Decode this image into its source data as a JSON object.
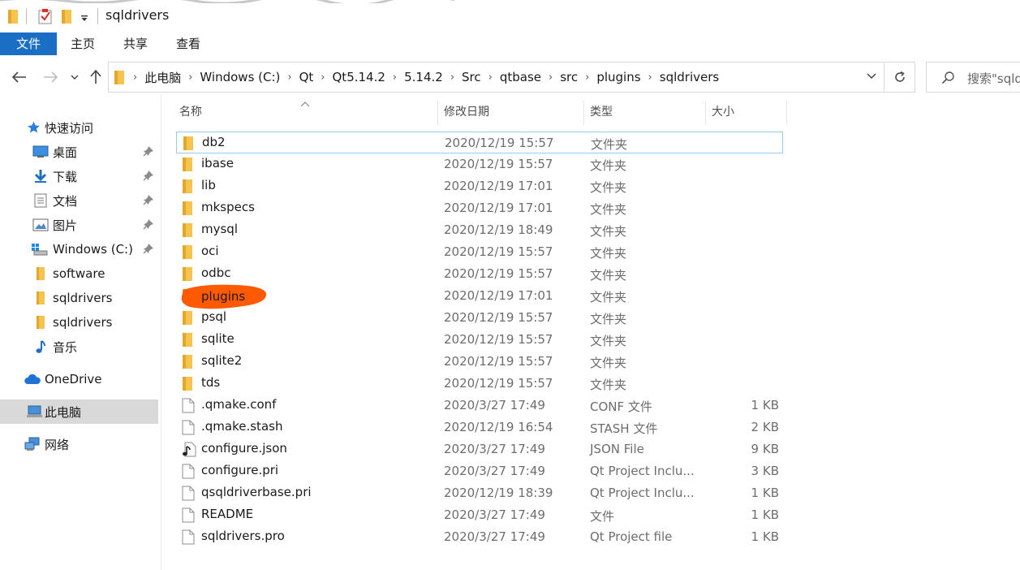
{
  "window": {
    "title": "sqldrivers"
  },
  "ribbon": {
    "tabs": [
      {
        "label": "文件",
        "active": true
      },
      {
        "label": "主页"
      },
      {
        "label": "共享"
      },
      {
        "label": "查看"
      }
    ]
  },
  "address": {
    "crumbs": [
      "此电脑",
      "Windows (C:)",
      "Qt",
      "Qt5.14.2",
      "5.14.2",
      "Src",
      "qtbase",
      "src",
      "plugins",
      "sqldrivers"
    ]
  },
  "search": {
    "placeholder": "搜索\"sqldrivers\""
  },
  "sidebar": {
    "items": [
      {
        "label": "快速访问",
        "icon": "star-icon",
        "pinned": false
      },
      {
        "label": "桌面",
        "icon": "desktop-icon",
        "pinned": true
      },
      {
        "label": "下载",
        "icon": "download-icon",
        "pinned": true
      },
      {
        "label": "文档",
        "icon": "document-icon",
        "pinned": true
      },
      {
        "label": "图片",
        "icon": "pictures-icon",
        "pinned": true
      },
      {
        "label": "Windows (C:)",
        "icon": "drive-icon",
        "pinned": true
      },
      {
        "label": "software",
        "icon": "folder-icon",
        "pinned": false
      },
      {
        "label": "sqldrivers",
        "icon": "folder-icon",
        "pinned": false
      },
      {
        "label": "sqldrivers",
        "icon": "folder-icon",
        "pinned": false
      },
      {
        "label": "音乐",
        "icon": "music-icon",
        "pinned": false
      },
      {
        "label": "OneDrive",
        "icon": "cloud-icon",
        "pinned": false
      },
      {
        "label": "此电脑",
        "icon": "computer-icon",
        "pinned": false,
        "selected": true
      },
      {
        "label": "网络",
        "icon": "network-icon",
        "pinned": false
      }
    ]
  },
  "columns": {
    "name": "名称",
    "date": "修改日期",
    "type": "类型",
    "size": "大小"
  },
  "files": [
    {
      "name": "db2",
      "date": "2020/12/19 15:57",
      "type": "文件夹",
      "size": "",
      "kind": "folder"
    },
    {
      "name": "ibase",
      "date": "2020/12/19 15:57",
      "type": "文件夹",
      "size": "",
      "kind": "folder"
    },
    {
      "name": "lib",
      "date": "2020/12/19 17:01",
      "type": "文件夹",
      "size": "",
      "kind": "folder"
    },
    {
      "name": "mkspecs",
      "date": "2020/12/19 17:01",
      "type": "文件夹",
      "size": "",
      "kind": "folder"
    },
    {
      "name": "mysql",
      "date": "2020/12/19 18:49",
      "type": "文件夹",
      "size": "",
      "kind": "folder"
    },
    {
      "name": "oci",
      "date": "2020/12/19 15:57",
      "type": "文件夹",
      "size": "",
      "kind": "folder"
    },
    {
      "name": "odbc",
      "date": "2020/12/19 15:57",
      "type": "文件夹",
      "size": "",
      "kind": "folder"
    },
    {
      "name": "plugins",
      "date": "2020/12/19 17:01",
      "type": "文件夹",
      "size": "",
      "kind": "folder"
    },
    {
      "name": "psql",
      "date": "2020/12/19 15:57",
      "type": "文件夹",
      "size": "",
      "kind": "folder"
    },
    {
      "name": "sqlite",
      "date": "2020/12/19 15:57",
      "type": "文件夹",
      "size": "",
      "kind": "folder"
    },
    {
      "name": "sqlite2",
      "date": "2020/12/19 15:57",
      "type": "文件夹",
      "size": "",
      "kind": "folder"
    },
    {
      "name": "tds",
      "date": "2020/12/19 15:57",
      "type": "文件夹",
      "size": "",
      "kind": "folder"
    },
    {
      "name": ".qmake.conf",
      "date": "2020/3/27 17:49",
      "type": "CONF 文件",
      "size": "1 KB",
      "kind": "file"
    },
    {
      "name": ".qmake.stash",
      "date": "2020/12/19 16:54",
      "type": "STASH 文件",
      "size": "2 KB",
      "kind": "file"
    },
    {
      "name": "configure.json",
      "date": "2020/3/27 17:49",
      "type": "JSON File",
      "size": "9 KB",
      "kind": "json"
    },
    {
      "name": "configure.pri",
      "date": "2020/3/27 17:49",
      "type": "Qt Project Inclu...",
      "size": "3 KB",
      "kind": "file"
    },
    {
      "name": "qsqldriverbase.pri",
      "date": "2020/12/19 18:39",
      "type": "Qt Project Inclu...",
      "size": "1 KB",
      "kind": "file"
    },
    {
      "name": "README",
      "date": "2020/3/27 17:49",
      "type": "文件",
      "size": "1 KB",
      "kind": "file"
    },
    {
      "name": "sqldrivers.pro",
      "date": "2020/3/27 17:49",
      "type": "Qt Project file",
      "size": "1 KB",
      "kind": "file"
    }
  ],
  "colors": {
    "accent": "#1a6fc4",
    "folder": "#f4c44e",
    "annotation": "#ff5a00"
  }
}
